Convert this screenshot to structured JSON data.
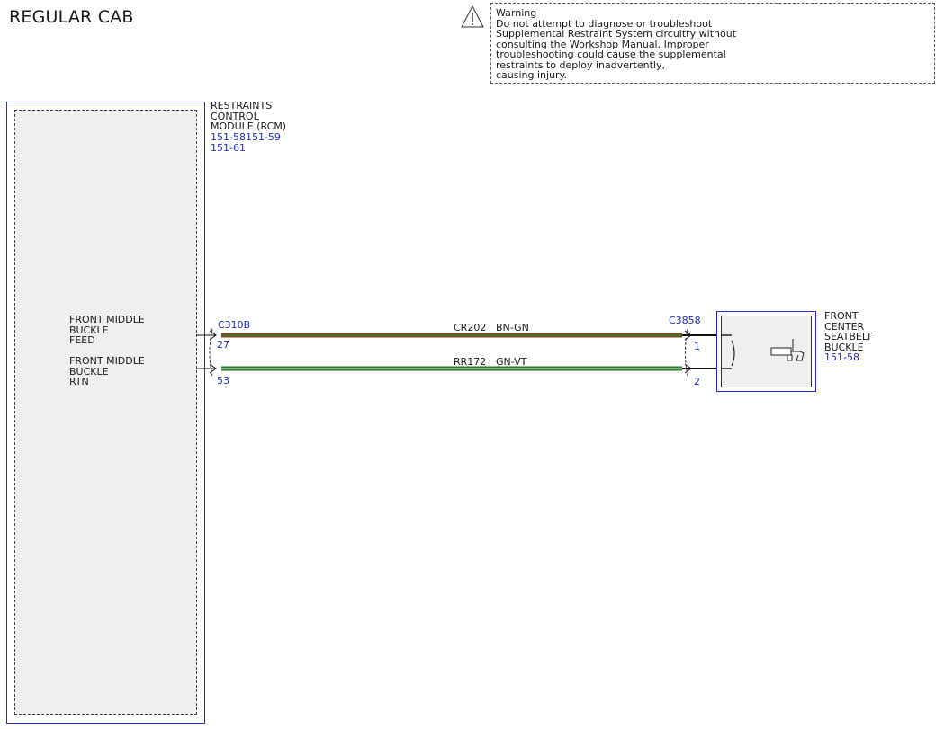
{
  "title": "REGULAR CAB",
  "warning": {
    "icon": "warning-triangle-icon",
    "text": "Warning\nDo not attempt to diagnose or troubleshoot\nSupplemental Restraint System circuitry without\nconsulting the Workshop Manual. Improper\ntroubleshooting could cause the supplemental\nrestraints to deploy inadvertently,\ncausing injury."
  },
  "rcm": {
    "name": "RESTRAINTS\nCONTROL\nMODULE (RCM)",
    "refs": "151-58151-59\n151-61",
    "connector": "C310B",
    "feed_label": "FRONT MIDDLE\nBUCKLE\nFEED",
    "rtn_label": "FRONT MIDDLE\nBUCKLE\nRTN",
    "pin_feed": "27",
    "pin_rtn": "53"
  },
  "buckle": {
    "name": "FRONT\nCENTER\nSEATBELT\nBUCKLE",
    "ref": "151-58",
    "connector": "C3858",
    "pin_feed": "1",
    "pin_rtn": "2"
  },
  "wires": [
    {
      "circuit": "CR202",
      "color_code": "BN-GN",
      "color": "#7b4a22",
      "tracer": "#2e7d2e"
    },
    {
      "circuit": "RR172",
      "color_code": "GN-VT",
      "color": "#2e7d2e",
      "tracer": "#b9e0b9"
    }
  ],
  "colors": {
    "accent": "#1f2fc4",
    "module_border": "#2230d0"
  }
}
